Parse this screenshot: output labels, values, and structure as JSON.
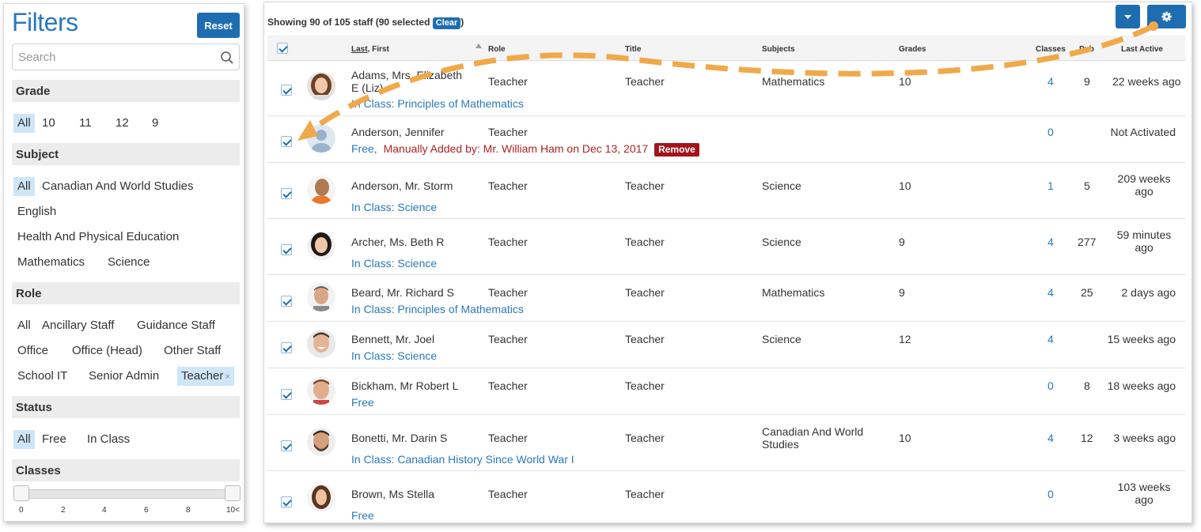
{
  "filters": {
    "title": "Filters",
    "reset_label": "Reset",
    "search_placeholder": "Search",
    "grade": {
      "header": "Grade",
      "options": [
        "All",
        "10",
        "11",
        "12",
        "9"
      ]
    },
    "subject": {
      "header": "Subject",
      "options": [
        "All",
        "Canadian And World Studies",
        "English",
        "Health And Physical Education",
        "Mathematics",
        "Science"
      ]
    },
    "role": {
      "header": "Role",
      "options": [
        "All",
        "Ancillary Staff",
        "Guidance Staff",
        "Office",
        "Office (Head)",
        "Other Staff",
        "School IT",
        "Senior Admin",
        "Teacher"
      ],
      "remove_glyph": "×"
    },
    "status": {
      "header": "Status",
      "options": [
        "All",
        "Free",
        "In Class"
      ]
    },
    "classes": {
      "header": "Classes",
      "ticks": [
        "0",
        "2",
        "4",
        "6",
        "8",
        "10<"
      ],
      "range": [
        0,
        10
      ]
    }
  },
  "toolbar": {
    "showing_text": "Showing 90 of 105 staff",
    "selected_text": "(90 selected",
    "clear_label": "Clear",
    "close_paren": ")",
    "dropdown_icon": "caret-down-icon",
    "settings_icon": "gear-icon"
  },
  "table": {
    "columns": {
      "name_last": "Last",
      "name_first": ", First",
      "role": "Role",
      "title": "Title",
      "subjects": "Subjects",
      "grades": "Grades",
      "classes": "Classes",
      "pub": "Pub",
      "last_active": "Last Active"
    },
    "rows": [
      {
        "name": "Adams, Mrs. Elizabeth E (Liz)",
        "role": "Teacher",
        "title": "Teacher",
        "subjects": "Mathematics",
        "grades": "10",
        "classes": "4",
        "pub": "9",
        "last_active": "22 weeks ago",
        "status": "In Class: Principles of Mathematics",
        "avatar": "woman-brown-hair"
      },
      {
        "name": "Anderson, Jennifer",
        "role": "Teacher",
        "title": "",
        "subjects": "",
        "grades": "",
        "classes": "0",
        "pub": "",
        "last_active": "Not Activated",
        "status": "Free,",
        "note": "Manually Added by: Mr. William Ham on Dec 13, 2017",
        "remove_label": "Remove",
        "avatar": "default-avatar"
      },
      {
        "name": "Anderson, Mr. Storm",
        "role": "Teacher",
        "title": "Teacher",
        "subjects": "Science",
        "grades": "10",
        "classes": "1",
        "pub": "5",
        "last_active": "209 weeks ago",
        "status": "In Class: Science",
        "avatar": "man-orange-shirt"
      },
      {
        "name": "Archer, Ms. Beth R",
        "role": "Teacher",
        "title": "Teacher",
        "subjects": "Science",
        "grades": "9",
        "classes": "4",
        "pub": "277",
        "last_active": "59 minutes ago",
        "status": "In Class: Science",
        "avatar": "woman-dark-hair"
      },
      {
        "name": "Beard, Mr. Richard S",
        "role": "Teacher",
        "title": "Teacher",
        "subjects": "Mathematics",
        "grades": "9",
        "classes": "4",
        "pub": "25",
        "last_active": "2 days ago",
        "status": "In Class: Principles of Mathematics",
        "avatar": "man-gray"
      },
      {
        "name": "Bennett, Mr. Joel",
        "role": "Teacher",
        "title": "Teacher",
        "subjects": "Science",
        "grades": "12",
        "classes": "4",
        "pub": "",
        "last_active": "15 weeks ago",
        "status": "In Class: Science",
        "avatar": "man-laughing"
      },
      {
        "name": "Bickham, Mr Robert L",
        "role": "Teacher",
        "title": "Teacher",
        "subjects": "",
        "grades": "",
        "classes": "0",
        "pub": "8",
        "last_active": "18 weeks ago",
        "status": "Free",
        "avatar": "man-smiling"
      },
      {
        "name": "Bonetti, Mr. Darin S",
        "role": "Teacher",
        "title": "Teacher",
        "subjects": "Canadian And World Studies",
        "grades": "10",
        "classes": "4",
        "pub": "12",
        "last_active": "3 weeks ago",
        "status": "In Class: Canadian History Since World War I",
        "avatar": "man-beard"
      },
      {
        "name": "Brown, Ms Stella",
        "role": "Teacher",
        "title": "Teacher",
        "subjects": "",
        "grades": "",
        "classes": "0",
        "pub": "",
        "last_active": "103 weeks ago",
        "status": "Free",
        "avatar": "woman-brunette"
      }
    ]
  },
  "colors": {
    "accent": "#1f6db1",
    "link": "#2a78bd",
    "remove": "#a4131a",
    "arrow": "#f0a94a"
  }
}
